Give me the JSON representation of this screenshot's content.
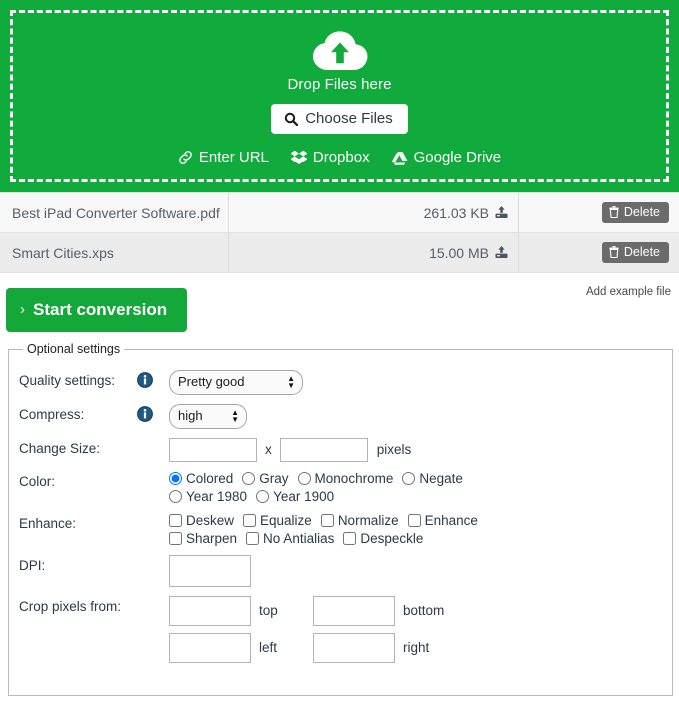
{
  "dropzone": {
    "icon": "cloud-upload-icon",
    "drop_label": "Drop Files here",
    "choose_button": "Choose Files",
    "choose_icon": "search-icon",
    "sources": [
      {
        "label": "Enter URL",
        "icon": "link-icon"
      },
      {
        "label": "Dropbox",
        "icon": "dropbox-icon"
      },
      {
        "label": "Google Drive",
        "icon": "google-drive-icon"
      }
    ],
    "bg_color": "#10ab3c"
  },
  "files": [
    {
      "name": "Best iPad Converter Software.pdf",
      "size": "261.03 KB",
      "status_icon": "upload-complete-icon",
      "delete_label": "Delete",
      "delete_icon": "trash-icon"
    },
    {
      "name": "Smart Cities.xps",
      "size": "15.00 MB",
      "status_icon": "upload-complete-icon",
      "delete_label": "Delete",
      "delete_icon": "trash-icon"
    }
  ],
  "actions": {
    "start_label": "Start conversion",
    "start_chevron": "›",
    "example_label": "Add example file",
    "start_color": "#14a83a"
  },
  "settings": {
    "legend": "Optional settings",
    "quality": {
      "label": "Quality settings:",
      "info_icon": "info-icon",
      "value": "Pretty good",
      "options": [
        "Pretty good"
      ]
    },
    "compress": {
      "label": "Compress:",
      "info_icon": "info-icon",
      "value": "high",
      "options": [
        "high"
      ]
    },
    "change_size": {
      "label": "Change Size:",
      "width_value": "",
      "height_value": "",
      "separator": "x",
      "unit": "pixels"
    },
    "color": {
      "label": "Color:",
      "selected": "Colored",
      "options_row1": [
        "Colored",
        "Gray",
        "Monochrome",
        "Negate"
      ],
      "options_row2": [
        "Year 1980",
        "Year 1900"
      ]
    },
    "enhance": {
      "label": "Enhance:",
      "options_row1": [
        "Deskew",
        "Equalize",
        "Normalize",
        "Enhance"
      ],
      "options_row2": [
        "Sharpen",
        "No Antialias",
        "Despeckle"
      ]
    },
    "dpi": {
      "label": "DPI:",
      "value": ""
    },
    "crop": {
      "label": "Crop pixels from:",
      "top_value": "",
      "top_label": "top",
      "bottom_value": "",
      "bottom_label": "bottom",
      "left_value": "",
      "left_label": "left",
      "right_value": "",
      "right_label": "right"
    }
  }
}
